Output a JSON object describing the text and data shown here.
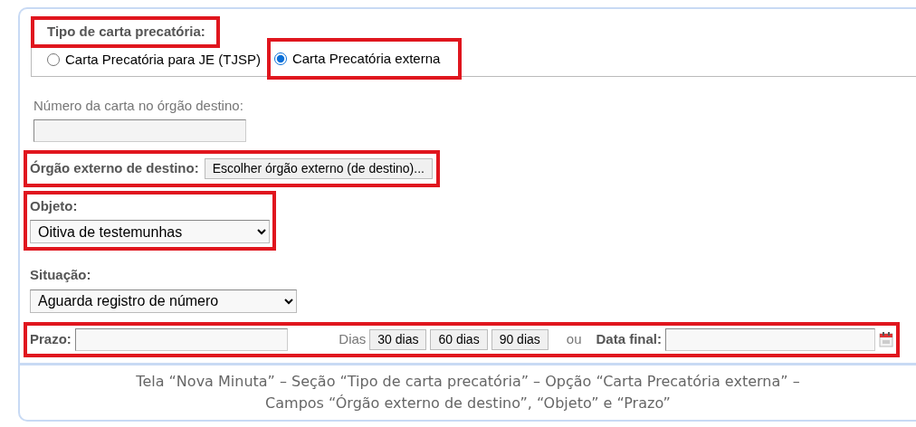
{
  "type_section": {
    "legend": "Tipo de carta precatória:",
    "highlighted": true,
    "options": [
      {
        "label": "Carta Precatória para JE (TJSP)",
        "selected": false,
        "highlighted": false
      },
      {
        "label": "Carta Precatória externa",
        "selected": true,
        "highlighted": true
      }
    ]
  },
  "numero": {
    "label": "Número da carta no órgão destino:",
    "disabled": true,
    "highlighted": false
  },
  "orgao": {
    "label": "Órgão externo de destino:",
    "button": "Escolher órgão externo (de destino)...",
    "highlighted": true
  },
  "objeto": {
    "label": "Objeto:",
    "value": "Oitiva de testemunhas",
    "highlighted": true
  },
  "situacao": {
    "label": "Situação:",
    "value": "Aguarda registro de número",
    "highlighted": false
  },
  "prazo": {
    "label": "Prazo:",
    "unit": "Dias",
    "buttons": [
      "30 dias",
      "60 dias",
      "90 dias"
    ],
    "separator": "ou",
    "date_label": "Data final:",
    "highlighted": true
  },
  "caption": [
    "Tela “Nova Minuta” – Seção “Tipo de carta precatória” – Opção “Carta Precatória externa” –",
    "Campos “Órgão externo de destino”, “Objeto” e “Prazo”"
  ]
}
